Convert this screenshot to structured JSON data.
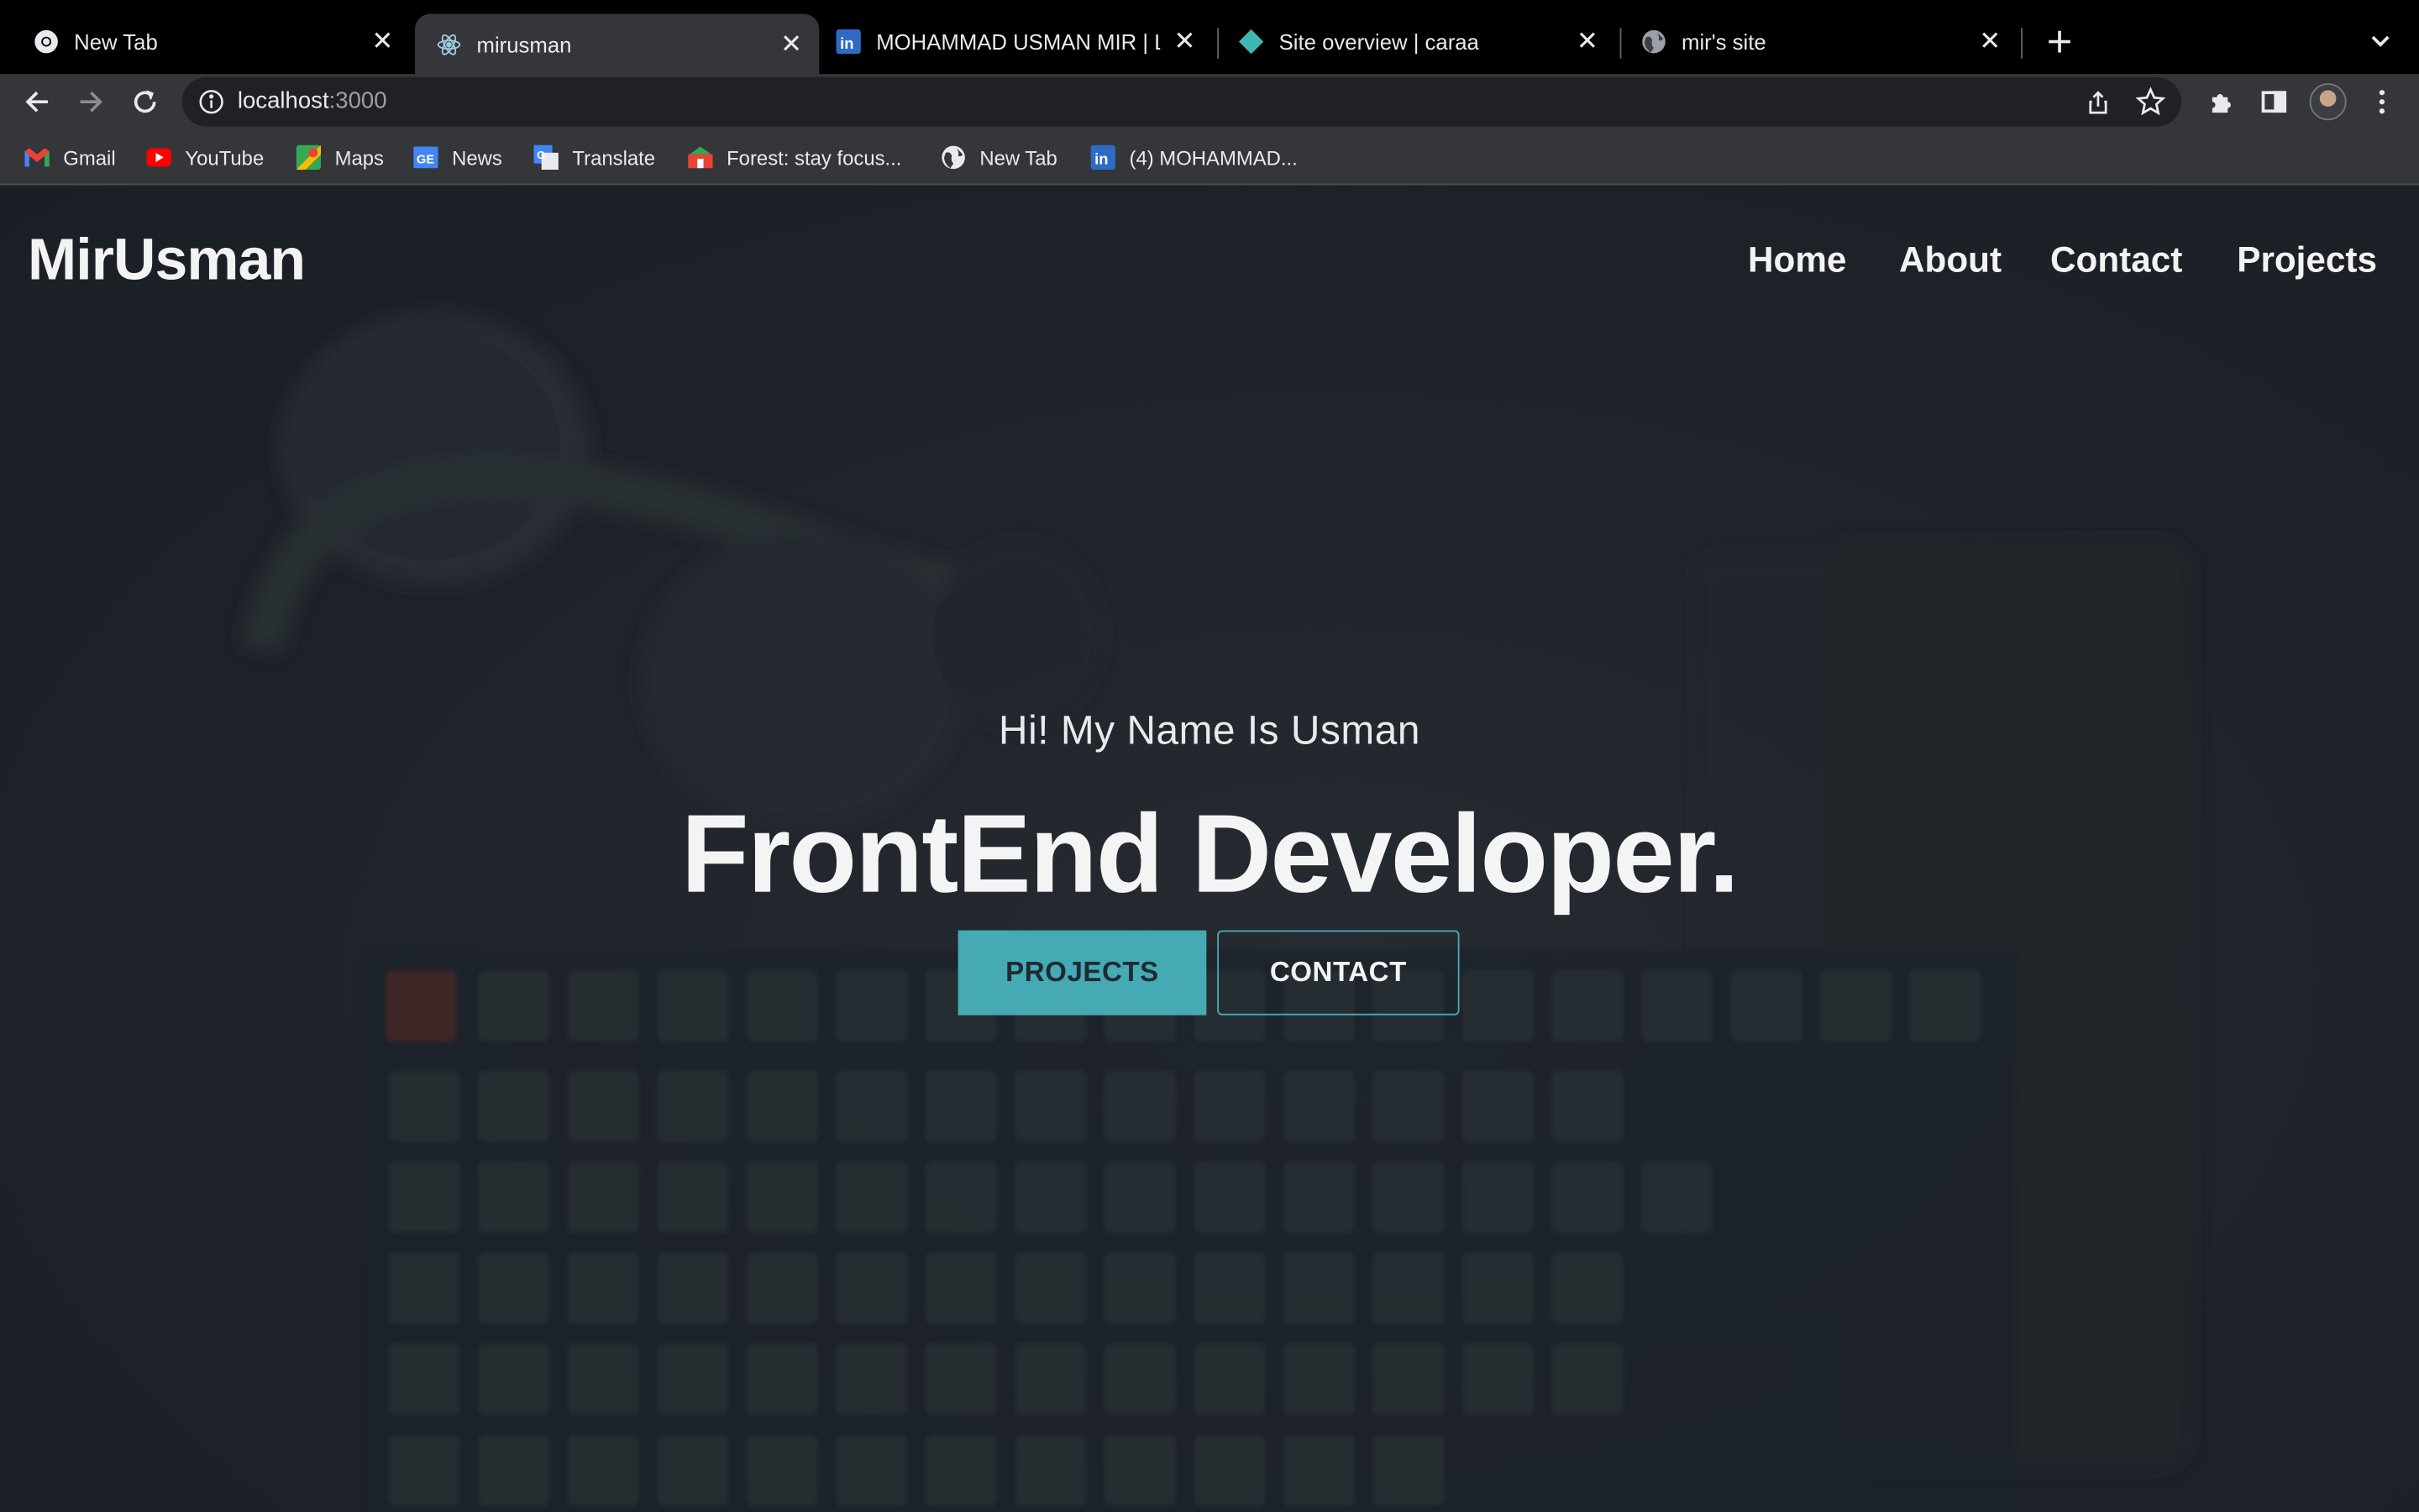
{
  "browser": {
    "tabs": [
      {
        "title": "New Tab",
        "icon": "chrome-icon",
        "active": false
      },
      {
        "title": "mirusman",
        "icon": "react-icon",
        "active": true
      },
      {
        "title": "MOHAMMAD USMAN MIR | Lin",
        "icon": "linkedin-icon",
        "active": false
      },
      {
        "title": "Site overview | caraa",
        "icon": "netlify-icon",
        "active": false
      },
      {
        "title": "mir's site",
        "icon": "globe-icon",
        "active": false
      }
    ],
    "url": {
      "host": "localhost",
      "port": ":3000"
    },
    "bookmarks": [
      {
        "label": "Gmail",
        "icon": "gmail-icon"
      },
      {
        "label": "YouTube",
        "icon": "youtube-icon"
      },
      {
        "label": "Maps",
        "icon": "maps-icon"
      },
      {
        "label": "News",
        "icon": "news-icon"
      },
      {
        "label": "Translate",
        "icon": "translate-icon"
      },
      {
        "label": "Forest: stay focus...",
        "icon": "forest-icon"
      },
      {
        "label": "New Tab",
        "icon": "globe-icon"
      },
      {
        "label": "(4) MOHAMMAD...",
        "icon": "linkedin-icon"
      }
    ]
  },
  "site": {
    "logo": "MirUsman",
    "nav": [
      "Home",
      "About",
      "Contact",
      "Projects"
    ],
    "hero": {
      "subtitle": "Hi! My Name Is Usman",
      "title": "FrontEnd Developer.",
      "buttons": {
        "projects": "PROJECTS",
        "contact": "CONTACT"
      }
    },
    "colors": {
      "accent": "#45aab4",
      "background": "#1e2329",
      "text": "#f3f3f3"
    }
  }
}
